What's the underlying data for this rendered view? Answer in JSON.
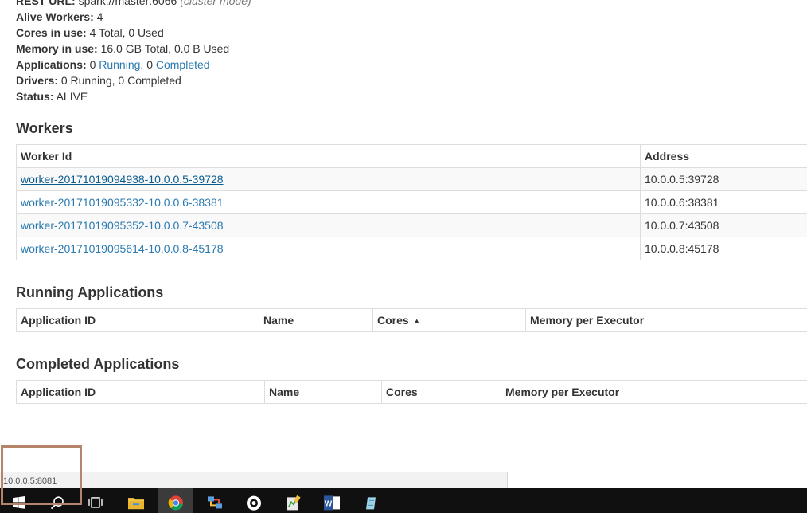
{
  "summary": {
    "rest_url_label": "REST URL:",
    "rest_url_value": "spark://master:6066",
    "rest_url_note": "(cluster mode)",
    "alive_workers_label": "Alive Workers:",
    "alive_workers_value": "4",
    "cores_label": "Cores in use:",
    "cores_value": "4 Total, 0 Used",
    "memory_label": "Memory in use:",
    "memory_value": "16.0 GB Total, 0.0 B Used",
    "applications_label": "Applications:",
    "applications_running_count": "0",
    "applications_running_link": "Running",
    "applications_sep": ",",
    "applications_completed_count": "0",
    "applications_completed_link": "Completed",
    "drivers_label": "Drivers:",
    "drivers_value": "0 Running, 0 Completed",
    "status_label": "Status:",
    "status_value": "ALIVE"
  },
  "workers": {
    "heading": "Workers",
    "columns": [
      "Worker Id",
      "Address"
    ],
    "rows": [
      {
        "id": "worker-20171019094938-10.0.0.5-39728",
        "address": "10.0.0.5:39728"
      },
      {
        "id": "worker-20171019095332-10.0.0.6-38381",
        "address": "10.0.0.6:38381"
      },
      {
        "id": "worker-20171019095352-10.0.0.7-43508",
        "address": "10.0.0.7:43508"
      },
      {
        "id": "worker-20171019095614-10.0.0.8-45178",
        "address": "10.0.0.8:45178"
      }
    ]
  },
  "running_apps": {
    "heading": "Running Applications",
    "columns": [
      "Application ID",
      "Name",
      "Cores",
      "Memory per Executor"
    ],
    "sort_indicator": "▲"
  },
  "completed_apps": {
    "heading": "Completed Applications",
    "columns": [
      "Application ID",
      "Name",
      "Cores",
      "Memory per Executor"
    ]
  },
  "status_bar": {
    "url": "10.0.0.5:8081"
  },
  "taskbar": {
    "icons": [
      "windows-start-icon",
      "search-icon",
      "task-view-icon",
      "file-explorer-icon",
      "chrome-icon",
      "network-app-icon",
      "settings-app-icon",
      "editor-app-icon",
      "word-icon",
      "notepad-app-icon"
    ]
  },
  "colors": {
    "link": "#2a7ab0",
    "highlight_box": "#b5856a",
    "taskbar": "#101010"
  }
}
